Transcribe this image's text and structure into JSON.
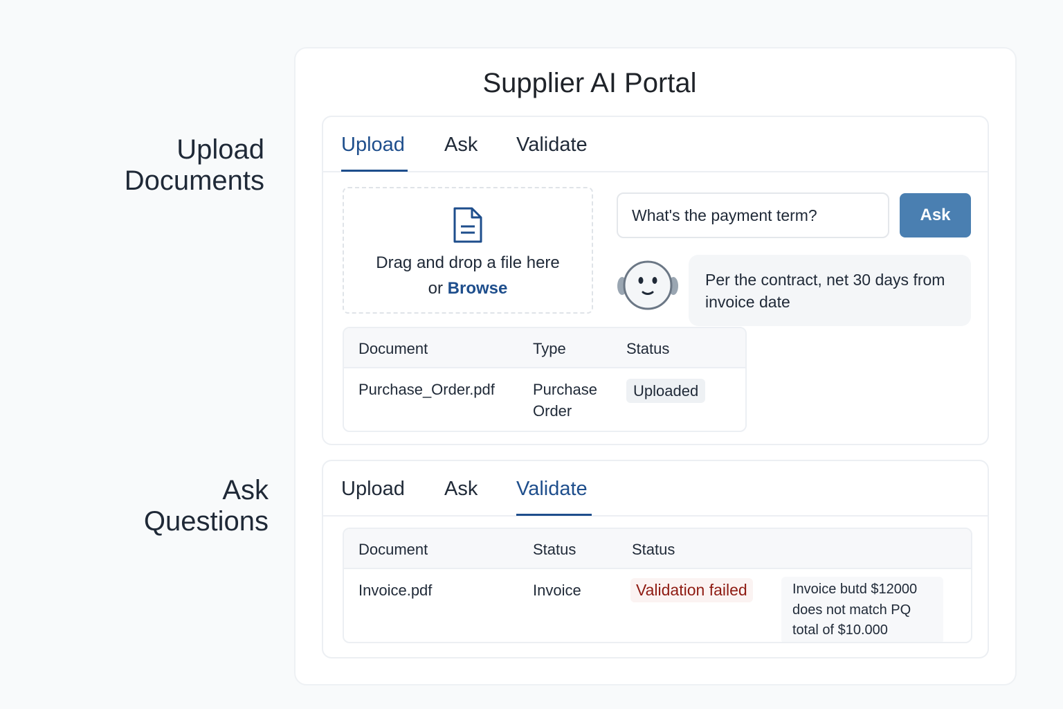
{
  "side_labels": {
    "upload": "Upload Documents",
    "ask": "Ask Questions"
  },
  "portal": {
    "title": "Supplier AI Portal"
  },
  "upload_card": {
    "tabs": [
      {
        "label": "Upload",
        "active": true
      },
      {
        "label": "Ask",
        "active": false
      },
      {
        "label": "Validate",
        "active": false
      }
    ],
    "dropzone": {
      "icon": "document-icon",
      "text": "Drag and drop a file here",
      "or_text": "or",
      "browse_label": "Browse"
    },
    "ask": {
      "input_value": "What's the payment term?",
      "button_label": "Ask",
      "avatar_icon": "bot-avatar-icon",
      "answer": "Per the contract, net 30 days from invoice date"
    },
    "table": {
      "columns": [
        "Document",
        "Type",
        "Status"
      ],
      "rows": [
        {
          "document": "Purchase_Order.pdf",
          "type": "Purchase Order",
          "status": "Uploaded"
        }
      ]
    }
  },
  "validate_card": {
    "tabs": [
      {
        "label": "Upload",
        "active": false
      },
      {
        "label": "Ask",
        "active": false
      },
      {
        "label": "Validate",
        "active": true
      }
    ],
    "table": {
      "columns": [
        "Document",
        "Status",
        "Status"
      ],
      "rows": [
        {
          "document": "Invoice.pdf",
          "type": "Invoice",
          "status": "Validation failed",
          "note": "Invoice butd $12000 does not match PQ total of $10.000"
        }
      ]
    }
  },
  "colors": {
    "accent": "#1e4e8c",
    "button": "#4a7fb1",
    "error": "#8e1b12",
    "background": "#f8fafb"
  }
}
